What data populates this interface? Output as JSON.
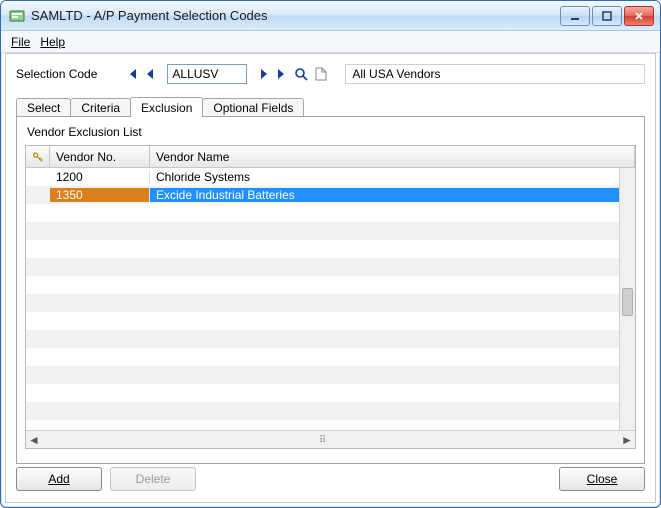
{
  "window": {
    "title": "SAMLTD - A/P Payment Selection Codes"
  },
  "menu": {
    "file": "File",
    "help": "Help"
  },
  "selection": {
    "label": "Selection Code",
    "code": "ALLUSV",
    "description": "All USA Vendors"
  },
  "tabs": {
    "select": "Select",
    "criteria": "Criteria",
    "exclusion": "Exclusion",
    "optional": "Optional Fields",
    "active": "exclusion"
  },
  "exclusion": {
    "panel_title": "Vendor Exclusion List",
    "columns": {
      "vendor_no": "Vendor No.",
      "vendor_name": "Vendor Name"
    },
    "rows": [
      {
        "no": "1200",
        "name": "Chloride Systems",
        "selected": false
      },
      {
        "no": "1350",
        "name": "Excide Industrial Batteries",
        "selected": true
      }
    ]
  },
  "buttons": {
    "add": "Add",
    "delete": "Delete",
    "close": "Close"
  }
}
